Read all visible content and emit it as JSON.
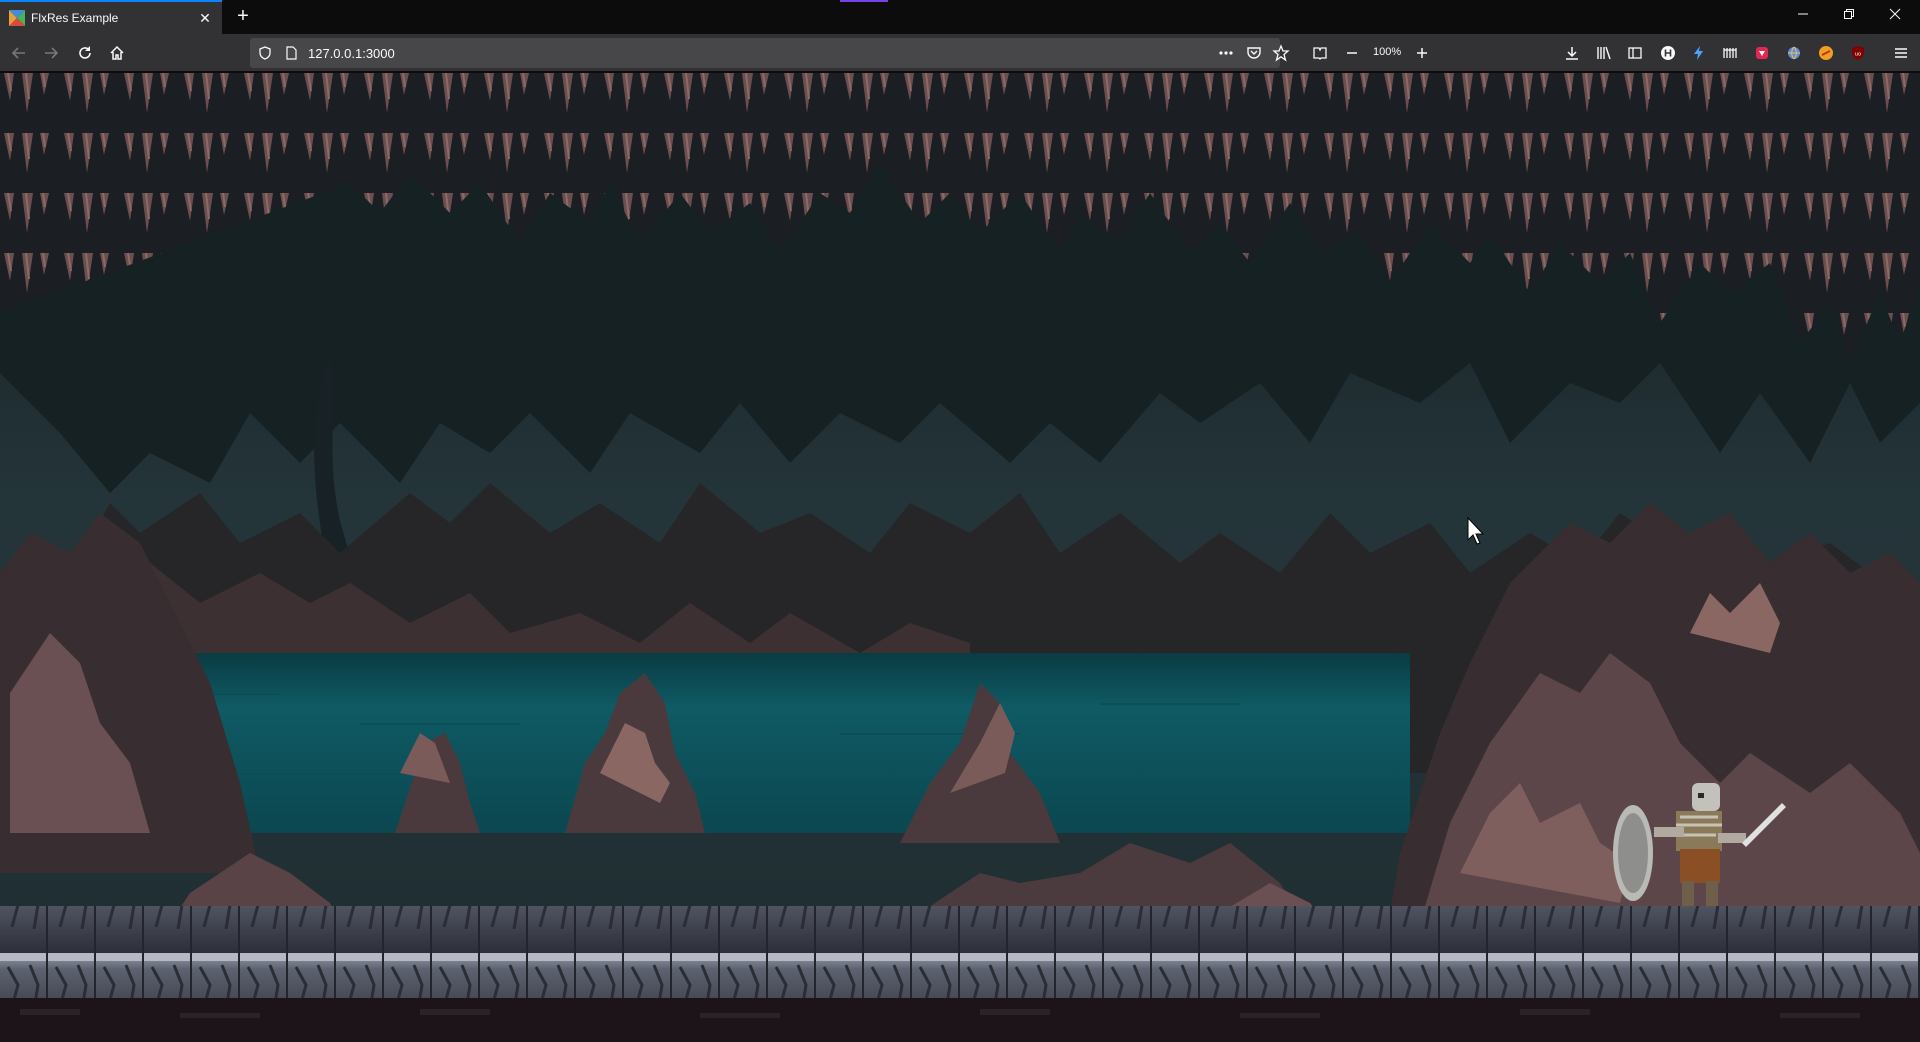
{
  "browser": {
    "tab": {
      "title": "FlxRes Example"
    },
    "url": "127.0.0.1:3000",
    "zoom": "100%"
  },
  "colors": {
    "tab_active": "#323234",
    "toolbar": "#323234",
    "urlbar": "#474749",
    "water": "#0f5560",
    "cave_rock": "#5a4548",
    "floor_stone": "#6e7380"
  },
  "icons": {
    "back": "arrow-left",
    "forward": "arrow-right",
    "reload": "reload",
    "home": "house",
    "tracking_protection": "shield",
    "page_info": "page",
    "page_actions": "ellipsis",
    "pocket": "pocket",
    "bookmark": "star",
    "reader": "reader-view",
    "zoom_out": "minus",
    "zoom_in": "plus",
    "downloads": "download",
    "library": "library",
    "sidebar": "sidebar",
    "menu": "hamburger"
  }
}
